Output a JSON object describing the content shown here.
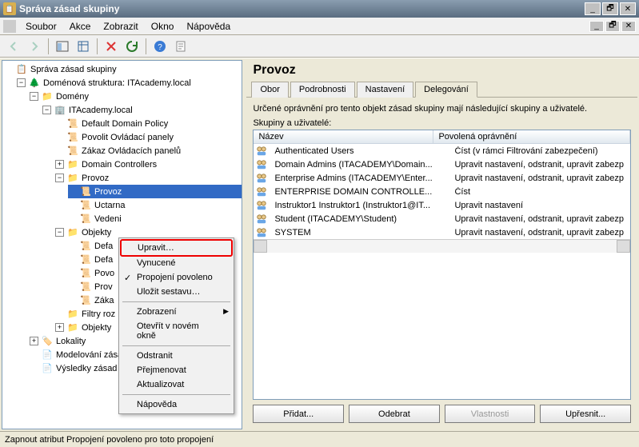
{
  "title": "Správa zásad skupiny",
  "menubar": [
    "Soubor",
    "Akce",
    "Zobrazit",
    "Okno",
    "Nápověda"
  ],
  "tree": {
    "root": "Správa zásad skupiny",
    "forest": "Doménová struktura: ITAcademy.local",
    "domains": "Domény",
    "domain": "ITAcademy.local",
    "ddp": "Default Domain Policy",
    "pov": "Povolit Ovládací panely",
    "zak": "Zákaz Ovládacích panelů",
    "dc": "Domain Controllers",
    "provoz": "Provoz",
    "provozGpo": "Provoz",
    "uctarna": "Uctarna",
    "vedeni": "Vedeni",
    "objekty": "Objekty",
    "defa": "Defa",
    "defa2": "Defa",
    "povo": "Povo",
    "prov": "Prov",
    "zaka": "Záka",
    "filtry": "Filtry roz",
    "objekty2": "Objekty",
    "lokality": "Lokality",
    "model": "Modelování zása",
    "vysl": "Výsledky zásad skupiny"
  },
  "context": {
    "upravit": "Upravit…",
    "vynucene": "Vynucené",
    "propojeni": "Propojení povoleno",
    "ulozit": "Uložit sestavu…",
    "zobrazeni": "Zobrazení",
    "otevrit": "Otevřít v novém okně",
    "odstranit": "Odstranit",
    "prejmenovat": "Přejmenovat",
    "aktualizovat": "Aktualizovat",
    "napoveda": "Nápověda"
  },
  "right": {
    "header": "Provoz",
    "tabs": [
      "Obor",
      "Podrobnosti",
      "Nastavení",
      "Delegování"
    ],
    "activeTab": 3,
    "desc": "Určené oprávnění pro tento objekt zásad skupiny mají následující skupiny a uživatelé.",
    "groupLabel": "Skupiny a uživatelé:",
    "cols": [
      "Název",
      "Povolená oprávnění"
    ],
    "rows": [
      {
        "name": "Authenticated Users",
        "perm": "Číst (v rámci Filtrování zabezpečení)"
      },
      {
        "name": "Domain Admins (ITACADEMY\\Domain...",
        "perm": "Upravit nastavení, odstranit, upravit zabezp"
      },
      {
        "name": "Enterprise Admins (ITACADEMY\\Enter...",
        "perm": "Upravit nastavení, odstranit, upravit zabezp"
      },
      {
        "name": "ENTERPRISE DOMAIN CONTROLLE...",
        "perm": "Číst"
      },
      {
        "name": "Instruktor1 Instruktor1 (Instruktor1@IT...",
        "perm": "Upravit nastavení"
      },
      {
        "name": "Student (ITACADEMY\\Student)",
        "perm": "Upravit nastavení, odstranit, upravit zabezp"
      },
      {
        "name": "SYSTEM",
        "perm": "Upravit nastavení, odstranit, upravit zabezp"
      }
    ],
    "buttons": {
      "add": "Přidat...",
      "remove": "Odebrat",
      "props": "Vlastnosti",
      "advanced": "Upřesnit..."
    }
  },
  "status": "Zapnout atribut Propojení povoleno pro toto propojení"
}
